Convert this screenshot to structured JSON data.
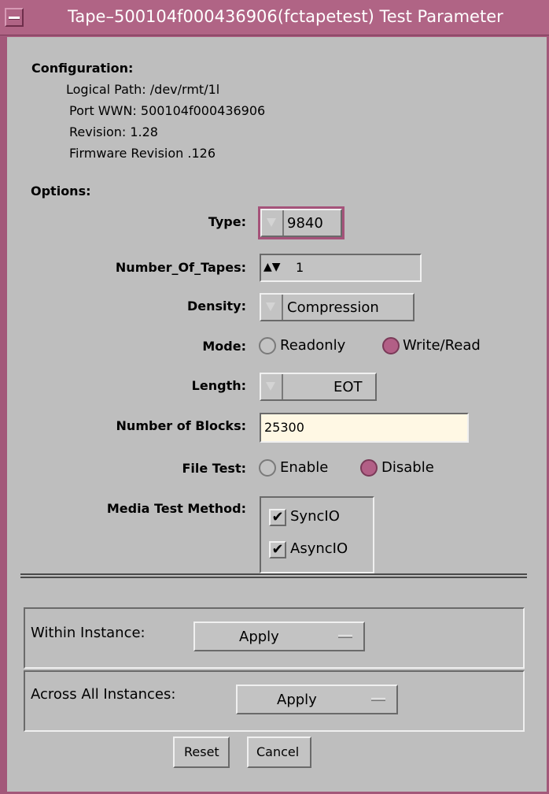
{
  "window": {
    "title": "Tape–500104f000436906(fctapetest) Test Parameter"
  },
  "configuration": {
    "heading": "Configuration:",
    "logical_path": "Logical Path: /dev/rmt/1l",
    "port_wwn": "Port WWN: 500104f000436906",
    "revision": "Revision: 1.28",
    "firmware_revision": "Firmware Revision .126"
  },
  "options": {
    "heading": "Options:",
    "type": {
      "label": "Type:",
      "value": "9840"
    },
    "number_of_tapes": {
      "label": "Number_Of_Tapes:",
      "arrows": "▲▼",
      "value": "1"
    },
    "density": {
      "label": "Density:",
      "value": "Compression"
    },
    "mode": {
      "label": "Mode:",
      "options": [
        "Readonly",
        "Write/Read"
      ],
      "selected": "Write/Read"
    },
    "length": {
      "label": "Length:",
      "value": "EOT"
    },
    "number_of_blocks": {
      "label": "Number of Blocks:",
      "value": "25300"
    },
    "file_test": {
      "label": "File Test:",
      "options": [
        "Enable",
        "Disable"
      ],
      "selected": "Disable"
    },
    "media_test_method": {
      "label": "Media Test Method:",
      "items": [
        {
          "label": "SyncIO",
          "checked": true
        },
        {
          "label": "AsyncIO",
          "checked": true
        }
      ]
    }
  },
  "within_instance": {
    "label": "Within Instance:",
    "value": "Apply"
  },
  "across_instances": {
    "label": "Across All Instances:",
    "value": "Apply"
  },
  "buttons": {
    "reset": "Reset",
    "cancel": "Cancel"
  },
  "colors": {
    "title_bar": "#b06485",
    "client_bg": "#bebebe",
    "accent": "#b25f86",
    "field_bg": "#fff8e4"
  },
  "icons": {
    "check": "✔"
  }
}
